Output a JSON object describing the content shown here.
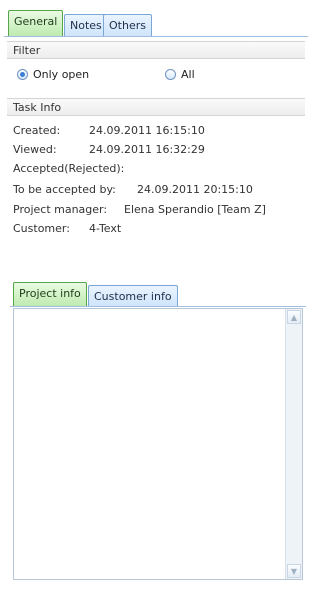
{
  "tabs": {
    "top": [
      {
        "label": "General",
        "active": true
      },
      {
        "label": "Notes",
        "active": false
      },
      {
        "label": "Others",
        "active": false
      }
    ],
    "bottom": [
      {
        "label": "Project info",
        "active": true
      },
      {
        "label": "Customer info",
        "active": false
      }
    ]
  },
  "filter": {
    "header": "Filter",
    "options": [
      {
        "label": "Only open",
        "checked": true
      },
      {
        "label": "All",
        "checked": false
      }
    ]
  },
  "task_info": {
    "header": "Task Info",
    "rows": [
      {
        "label": "Created:",
        "value": "24.09.2011 16:15:10"
      },
      {
        "label": "Viewed:",
        "value": "24.09.2011 16:32:29"
      },
      {
        "label": "Accepted(Rejected):",
        "value": ""
      },
      {
        "label": "To be accepted by:",
        "value": "24.09.2011 20:15:10"
      },
      {
        "label": "Project manager:",
        "value": "Elena Sperandio [Team Z]"
      },
      {
        "label": "Customer:",
        "value": "4-Text"
      }
    ]
  },
  "project_info": {
    "text": ""
  },
  "icons": {
    "scroll_up": "chevron-up-icon",
    "scroll_down": "chevron-down-icon"
  },
  "colors": {
    "active_tab": "#bfeab0",
    "inactive_tab": "#cfe4fb",
    "radio_selected": "#3a7fd6"
  }
}
